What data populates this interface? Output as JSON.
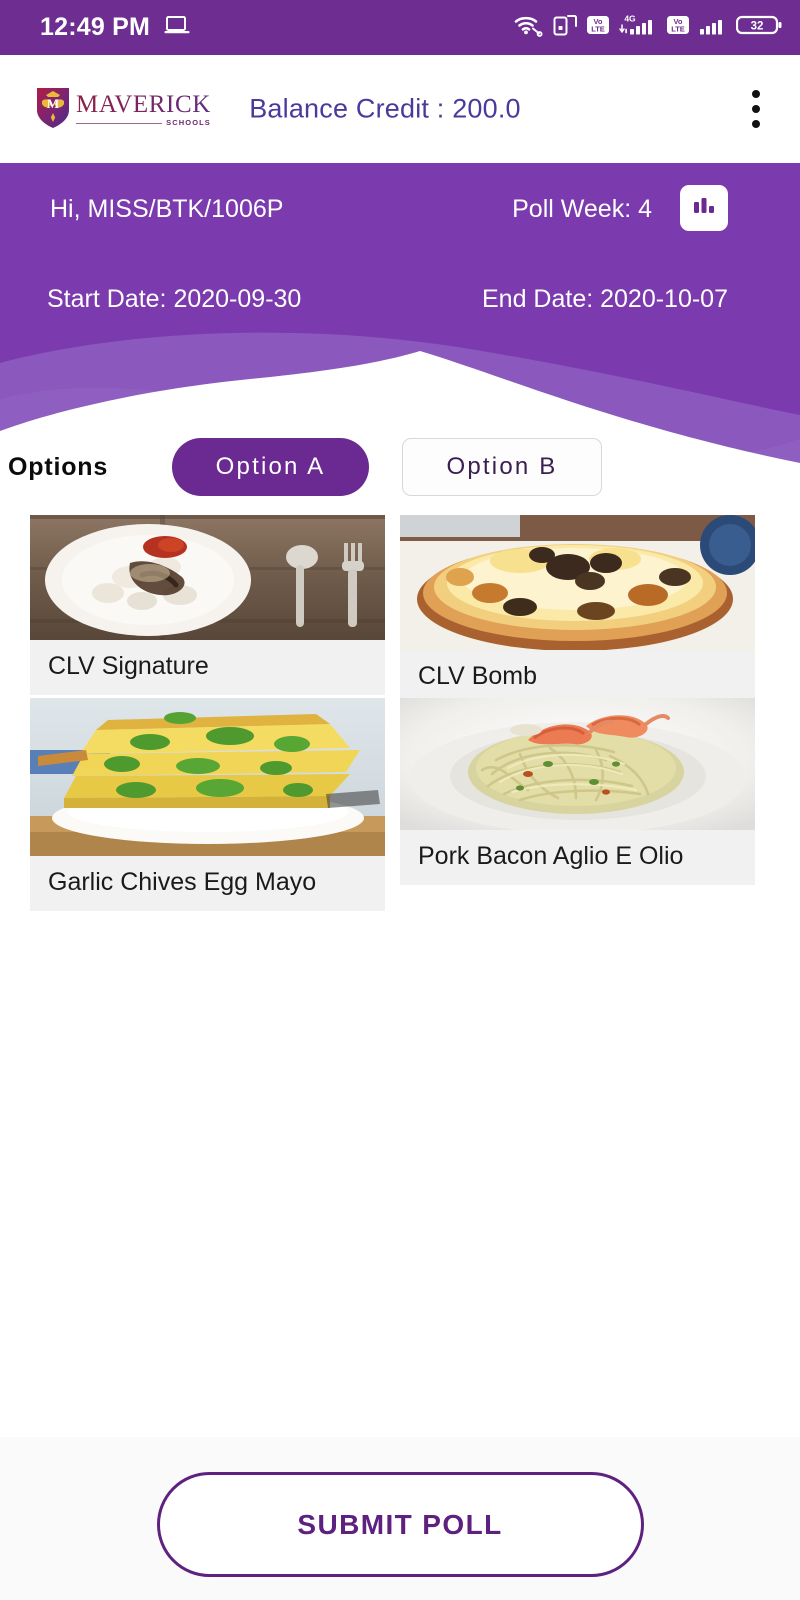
{
  "status_bar": {
    "time": "12:49 PM",
    "icons_left": [
      "laptop-cast-icon"
    ],
    "icons_right": [
      "wifi-vpn-icon",
      "screen-cast-icon",
      "volte-badge-icon",
      "signal-4g-icon",
      "volte-badge-2-icon",
      "signal-2-icon",
      "battery-icon"
    ],
    "battery_level": "32",
    "network_label_4g": "4G",
    "volte_label_top": "Vo",
    "volte_label_bottom": "LTE",
    "background_color": "#6D2D91"
  },
  "app_bar": {
    "logo_word": "MAVERICK",
    "logo_sub": "SCHOOLS",
    "balance_label": "Balance Credit : 200.0",
    "balance_color": "#4B3A9C",
    "overflow_menu": "more-options"
  },
  "hero": {
    "greeting": "Hi, MISS/BTK/1006P",
    "poll_week": "Poll Week: 4",
    "start_date": "Start Date: 2020-09-30",
    "end_date": "End Date: 2020-10-07",
    "chart_button": "poll-results",
    "background_color": "#7B3AAD",
    "wave_mid_color": "#8C5BBF",
    "wave_light_color": "#A98BD4"
  },
  "options": {
    "label": "Options",
    "tabs": [
      {
        "label": "Option A",
        "selected": true
      },
      {
        "label": "Option B",
        "selected": false
      }
    ],
    "selected_color": "#6A2A91"
  },
  "menu": {
    "items": [
      {
        "name": "CLV Signature"
      },
      {
        "name": "CLV Bomb"
      },
      {
        "name": "Garlic Chives Egg Mayo"
      },
      {
        "name": "Pork Bacon Aglio E Olio"
      }
    ]
  },
  "footer": {
    "submit_label": "SUBMIT POLL",
    "accent_color": "#5F2180"
  }
}
